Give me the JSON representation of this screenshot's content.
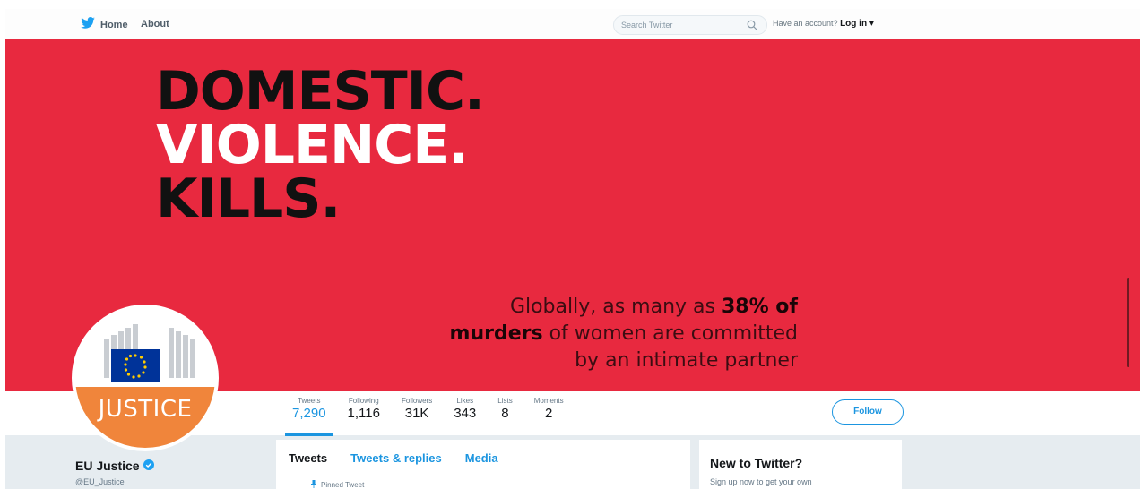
{
  "nav": {
    "home_label": "Home",
    "about_label": "About",
    "search_placeholder": "Search Twitter",
    "account_prompt": "Have an account?",
    "login_label": "Log in ▾"
  },
  "banner": {
    "line1": "DOMESTIC.",
    "line2": "VIOLENCE.",
    "line3": "KILLS.",
    "stat_part1": "Globally, as many as ",
    "stat_bold1": "38% of",
    "stat_bold2": "murders",
    "stat_part2": " of women are committed",
    "stat_part3": "by an intimate partner",
    "background_color": "#e8293f"
  },
  "avatar": {
    "text": "JUSTICE",
    "accent_color": "#f0853b"
  },
  "profile": {
    "name": "EU Justice",
    "handle": "@EU_Justice",
    "stats": [
      {
        "label": "Tweets",
        "value": "7,290"
      },
      {
        "label": "Following",
        "value": "1,116"
      },
      {
        "label": "Followers",
        "value": "31K"
      },
      {
        "label": "Likes",
        "value": "343"
      },
      {
        "label": "Lists",
        "value": "8"
      },
      {
        "label": "Moments",
        "value": "2"
      }
    ],
    "follow_label": "Follow"
  },
  "timeline": {
    "tabs": [
      "Tweets",
      "Tweets & replies",
      "Media"
    ],
    "pinned_label": "Pinned Tweet"
  },
  "sidebar": {
    "heading": "New to Twitter?",
    "subtext": "Sign up now to get your own"
  },
  "colors": {
    "twitter_blue": "#1b95e0",
    "eu_blue": "#003399",
    "eu_gold": "#ffcc00"
  }
}
